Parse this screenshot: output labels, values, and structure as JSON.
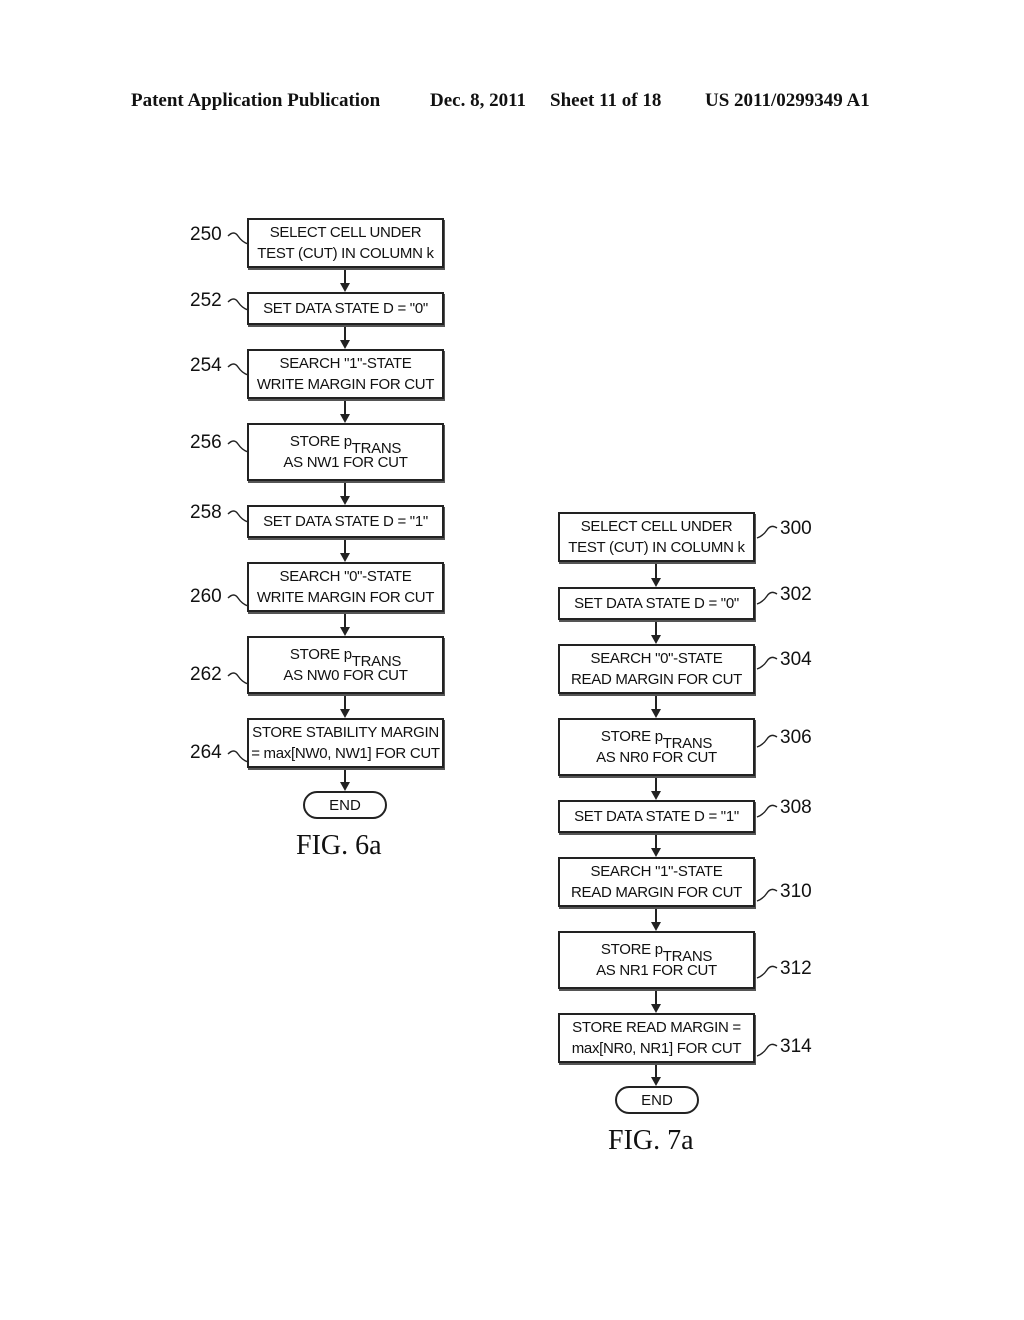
{
  "header": {
    "publication": "Patent Application Publication",
    "date": "Dec. 8, 2011",
    "sheet": "Sheet 11 of 18",
    "number": "US 2011/0299349 A1"
  },
  "fig6a": {
    "caption": "FIG. 6a",
    "end_label": "END",
    "steps": [
      {
        "ref": "250",
        "lines": [
          "SELECT CELL UNDER",
          "TEST (CUT) IN COLUMN k"
        ]
      },
      {
        "ref": "252",
        "lines": [
          "SET DATA STATE D = \"0\""
        ]
      },
      {
        "ref": "254",
        "lines": [
          "SEARCH \"1\"-STATE",
          "WRITE MARGIN FOR CUT"
        ]
      },
      {
        "ref": "256",
        "lines": [
          "STORE p",
          "AS NW1 FOR CUT"
        ],
        "subscript": "TRANS"
      },
      {
        "ref": "258",
        "lines": [
          "SET DATA STATE D = \"1\""
        ]
      },
      {
        "ref": "260",
        "lines": [
          "SEARCH \"0\"-STATE",
          "WRITE MARGIN FOR CUT"
        ]
      },
      {
        "ref": "262",
        "lines": [
          "STORE p",
          "AS NW0 FOR CUT"
        ],
        "subscript": "TRANS"
      },
      {
        "ref": "264",
        "lines": [
          "STORE STABILITY MARGIN",
          "= max[NW0, NW1] FOR CUT"
        ]
      }
    ]
  },
  "fig7a": {
    "caption": "FIG. 7a",
    "end_label": "END",
    "steps": [
      {
        "ref": "300",
        "lines": [
          "SELECT CELL UNDER",
          "TEST (CUT) IN COLUMN k"
        ]
      },
      {
        "ref": "302",
        "lines": [
          "SET DATA STATE D = \"0\""
        ]
      },
      {
        "ref": "304",
        "lines": [
          "SEARCH \"0\"-STATE",
          "READ MARGIN FOR CUT"
        ]
      },
      {
        "ref": "306",
        "lines": [
          "STORE p",
          "AS NR0 FOR CUT"
        ],
        "subscript": "TRANS"
      },
      {
        "ref": "308",
        "lines": [
          "SET DATA STATE D = \"1\""
        ]
      },
      {
        "ref": "310",
        "lines": [
          "SEARCH \"1\"-STATE",
          "READ MARGIN FOR CUT"
        ]
      },
      {
        "ref": "312",
        "lines": [
          "STORE p",
          "AS NR1 FOR CUT"
        ],
        "subscript": "TRANS"
      },
      {
        "ref": "314",
        "lines": [
          "STORE READ MARGIN =",
          "max[NR0, NR1] FOR CUT"
        ]
      }
    ]
  }
}
